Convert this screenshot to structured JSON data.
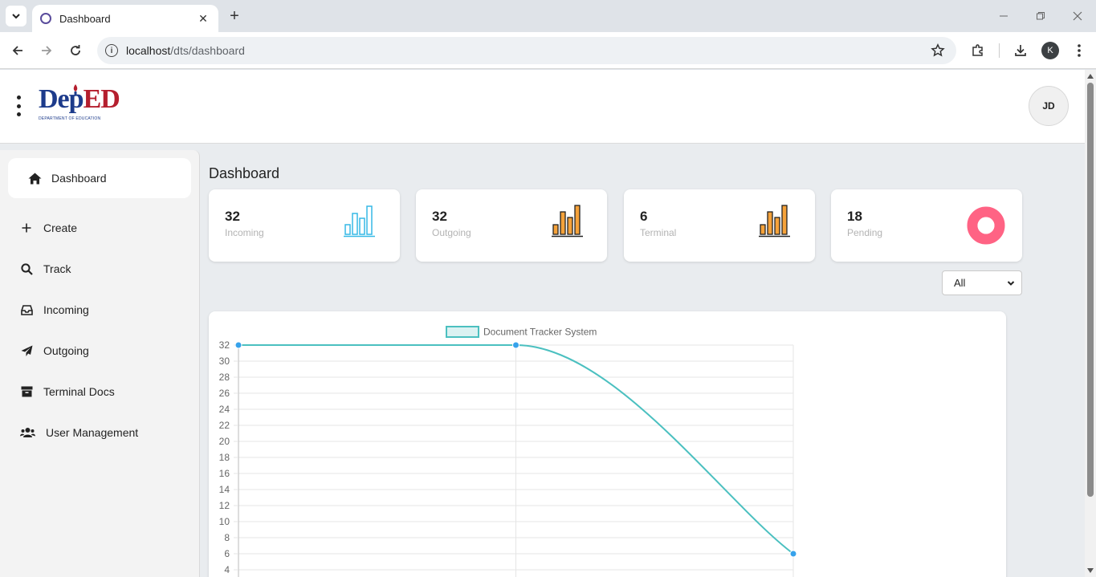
{
  "browser": {
    "tab_title": "Dashboard",
    "url_host": "localhost",
    "url_path": "/dts/dashboard",
    "profile_initial": "K"
  },
  "header": {
    "logo_text_1": "Dep",
    "logo_text_2": "ED",
    "logo_subtitle": "DEPARTMENT OF EDUCATION",
    "avatar_initials": "JD"
  },
  "sidebar": {
    "items": [
      {
        "label": "Dashboard",
        "icon": "home-icon"
      },
      {
        "label": "Create",
        "icon": "plus-icon"
      },
      {
        "label": "Track",
        "icon": "search-icon"
      },
      {
        "label": "Incoming",
        "icon": "inbox-icon"
      },
      {
        "label": "Outgoing",
        "icon": "paper-plane-icon"
      },
      {
        "label": "Terminal Docs",
        "icon": "archive-icon"
      },
      {
        "label": "User Management",
        "icon": "users-icon"
      }
    ]
  },
  "main": {
    "title": "Dashboard",
    "cards": [
      {
        "value": "32",
        "label": "Incoming",
        "icon": "bar-chart-outline-icon",
        "color": "#36b9e6"
      },
      {
        "value": "32",
        "label": "Outgoing",
        "icon": "bar-chart-filled-icon",
        "color": "#f5a23a"
      },
      {
        "value": "6",
        "label": "Terminal",
        "icon": "bar-chart-filled-icon",
        "color": "#f5a23a"
      },
      {
        "value": "18",
        "label": "Pending",
        "icon": "donut-chart-icon",
        "color": "#ff6384"
      }
    ],
    "filter": {
      "selected": "All"
    }
  },
  "chart_data": {
    "type": "line",
    "legend": "Document Tracker System",
    "legend_placement": "top-center",
    "series": [
      {
        "name": "Document Tracker System",
        "values": [
          32,
          32,
          6
        ]
      }
    ],
    "x_points": 3,
    "y_ticks": [
      "32",
      "30",
      "28",
      "26",
      "24",
      "22",
      "20",
      "18",
      "16",
      "14",
      "12",
      "10",
      "8",
      "6",
      "4"
    ],
    "ylim": [
      0,
      32
    ],
    "grid": true,
    "line_color": "#4bc0c0",
    "point_color": "#36a2eb"
  }
}
